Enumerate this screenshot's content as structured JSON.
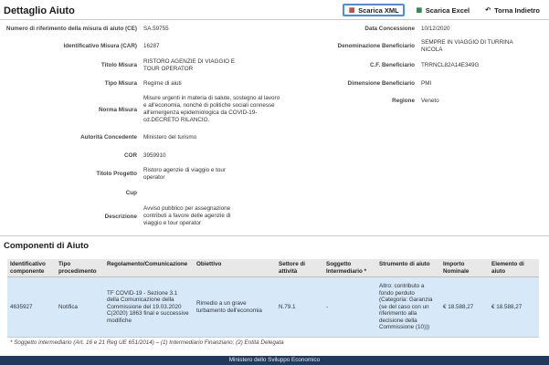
{
  "title": "Dettaglio Aiuto",
  "toolbar": {
    "xml_label": "Scarica XML",
    "excel_label": "Scarica Excel",
    "back_label": "Torna Indietro"
  },
  "left_fields": [
    {
      "label": "Numero di riferimento della misura di aiuto (CE)",
      "value": "SA.59755"
    },
    {
      "label": "Identificativo Misura (CAR)",
      "value": "16287"
    },
    {
      "label": "Titolo Misura",
      "value": "RISTORO AGENZIE DI VIAGGIO E TOUR OPERATOR"
    },
    {
      "label": "Tipo Misura",
      "value": "Regime di aiuti"
    },
    {
      "label": "Norma Misura",
      "value": "Misure urgenti in materia di salute, sostegno al lavoro e all'economia, nonché di politiche sociali connesse all'emergenza epidemiologica da COVID-19- cd.DECRETO RILANCIO."
    },
    {
      "label": "Autorità Concedente",
      "value": "Ministero del turismo"
    },
    {
      "label": "COR",
      "value": "3959910"
    },
    {
      "label": "Titolo Progetto",
      "value": "Ristoro agenzie di viaggio e tour operator"
    },
    {
      "label": "Cup",
      "value": ""
    },
    {
      "label": "Descrizione",
      "value": "Avviso pubblico per assegnazione contributi a favore delle agenzie di viaggio e tour operator"
    }
  ],
  "right_fields": [
    {
      "label": "Data Concessione",
      "value": "10/12/2020"
    },
    {
      "label": "Denominazione Beneficiario",
      "value": "SEMPRE IN VIAGGIO DI TURRINA NICOLA"
    },
    {
      "label": "C.F. Beneficiario",
      "value": "TRRNCL82A14E349G"
    },
    {
      "label": "Dimensione Beneficiario",
      "value": "PMI"
    },
    {
      "label": "Regione",
      "value": "Veneto"
    }
  ],
  "components": {
    "title": "Componenti di Aiuto",
    "headers": [
      "Identificativo componente",
      "Tipo procedimento",
      "Regolamento/Comunicazione",
      "Obiettivo",
      "Settore di attività",
      "Soggetto Intermediario *",
      "Strumento di aiuto",
      "Importo Nominale",
      "Elemento di aiuto"
    ],
    "rows": [
      [
        "4635927",
        "Notifica",
        "TF COVID-19 - Sezione 3.1 della Comunicazione della Commissione del 19.03.2020 C(2020) 1863 final e successive modifiche",
        "Rimedio a un grave turbamento dell'economia",
        "N.79.1",
        "-",
        "Altro: contributo a fondo perduto (Categoria: Garanzia (se del caso con un riferimento alla decisione della Commissione (10)))",
        "€ 18.588,27",
        "€ 18.588,27"
      ]
    ]
  },
  "footnote": "* Soggetto intermediario (Art. 16 e 21 Reg UE 651/2014) – (1) Intermediario Finanziario; (2) Entità Delegata",
  "footer": "Ministero dello Sviluppo Economico",
  "colors": {
    "footer_bg": "#213a5c",
    "row_highlight": "#d7e8f8",
    "active_border": "#4a90e2"
  }
}
